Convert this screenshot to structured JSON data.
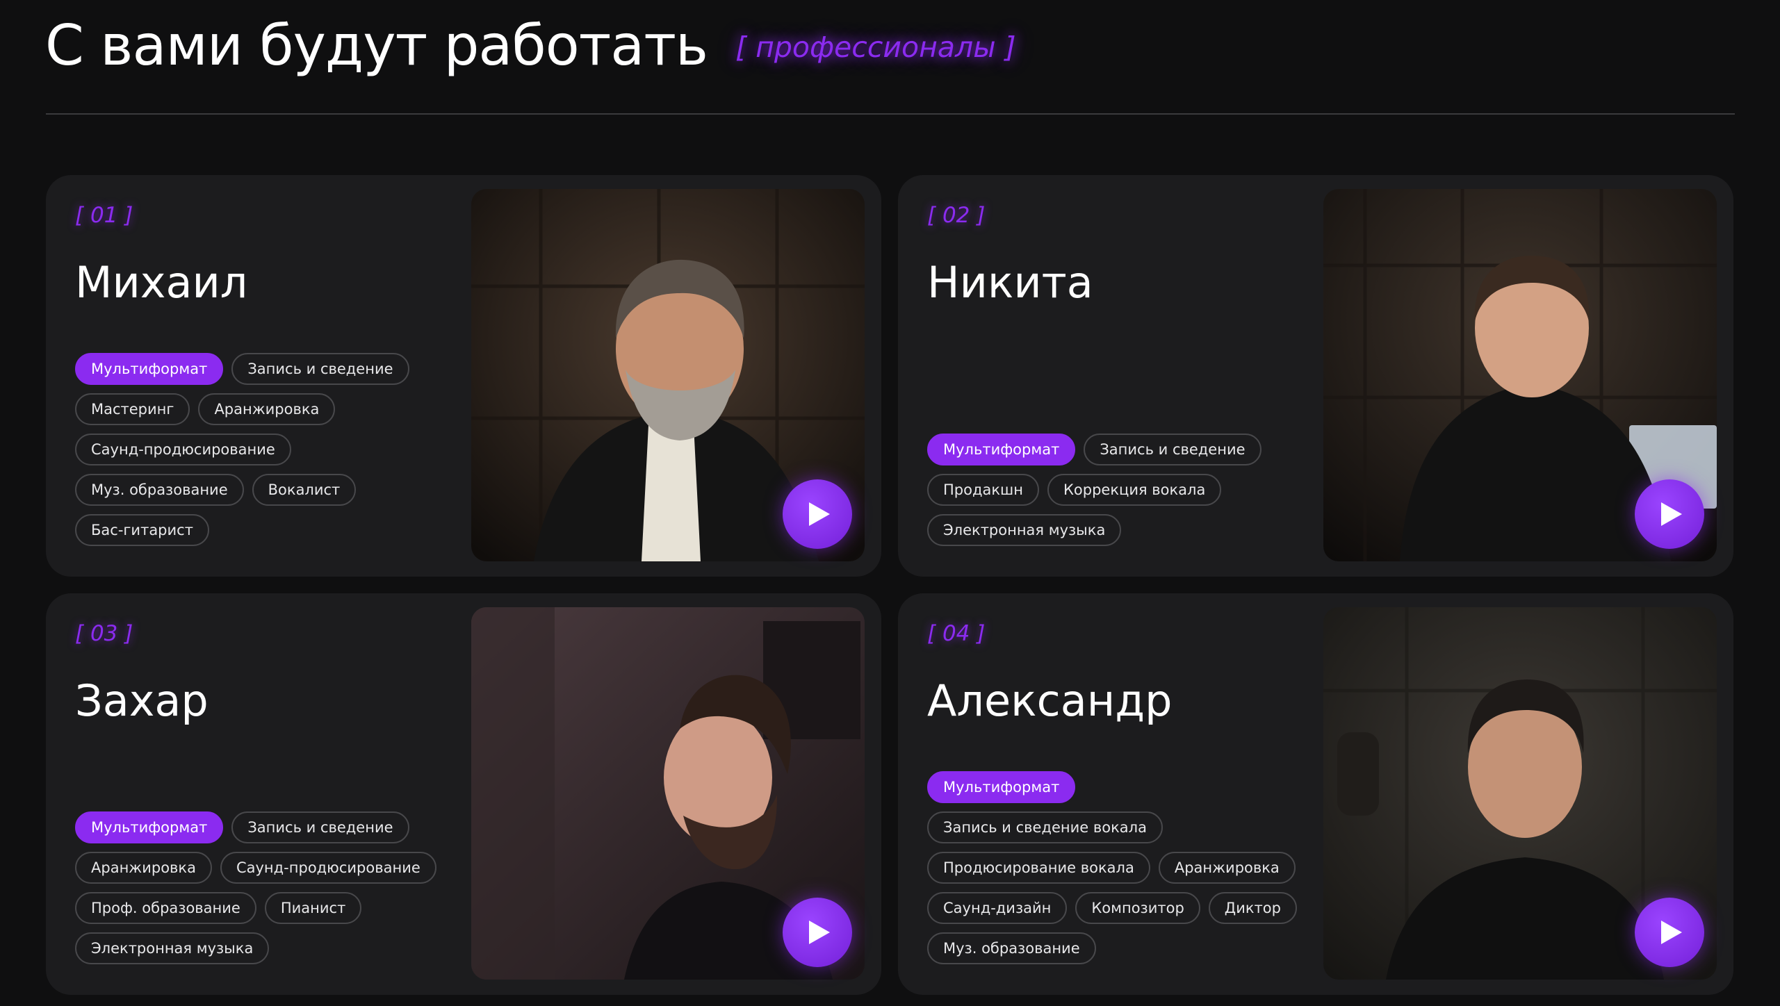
{
  "header": {
    "title": "С вами будут работать",
    "subtitle": "[ профессионалы ]"
  },
  "colors": {
    "accent": "#8b2bf0",
    "background": "#0f0f10",
    "card": "#1c1c1e"
  },
  "experts": [
    {
      "number": "[ 01 ]",
      "name": "Михаил",
      "tags": [
        "Мультиформат",
        "Запись и сведение",
        "Мастеринг",
        "Аранжировка",
        "Саунд-продюсирование",
        "Муз. образование",
        "Вокалист",
        "Бас-гитарист"
      ]
    },
    {
      "number": "[ 02 ]",
      "name": "Никита",
      "tags": [
        "Мультиформат",
        "Запись и сведение",
        "Продакшн",
        "Коррекция вокала",
        "Электронная музыка"
      ]
    },
    {
      "number": "[ 03 ]",
      "name": "Захар",
      "tags": [
        "Мультиформат",
        "Запись и сведение",
        "Аранжировка",
        "Саунд-продюсирование",
        "Проф. образование",
        "Пианист",
        "Электронная музыка"
      ]
    },
    {
      "number": "[ 04 ]",
      "name": "Александр",
      "tags": [
        "Мультиформат",
        "Запись и сведение вокала",
        "Продюсирование вокала",
        "Аранжировка",
        "Саунд-дизайн",
        "Композитор",
        "Диктор",
        "Муз. образование"
      ]
    }
  ],
  "icons": {
    "play": "play-icon"
  }
}
